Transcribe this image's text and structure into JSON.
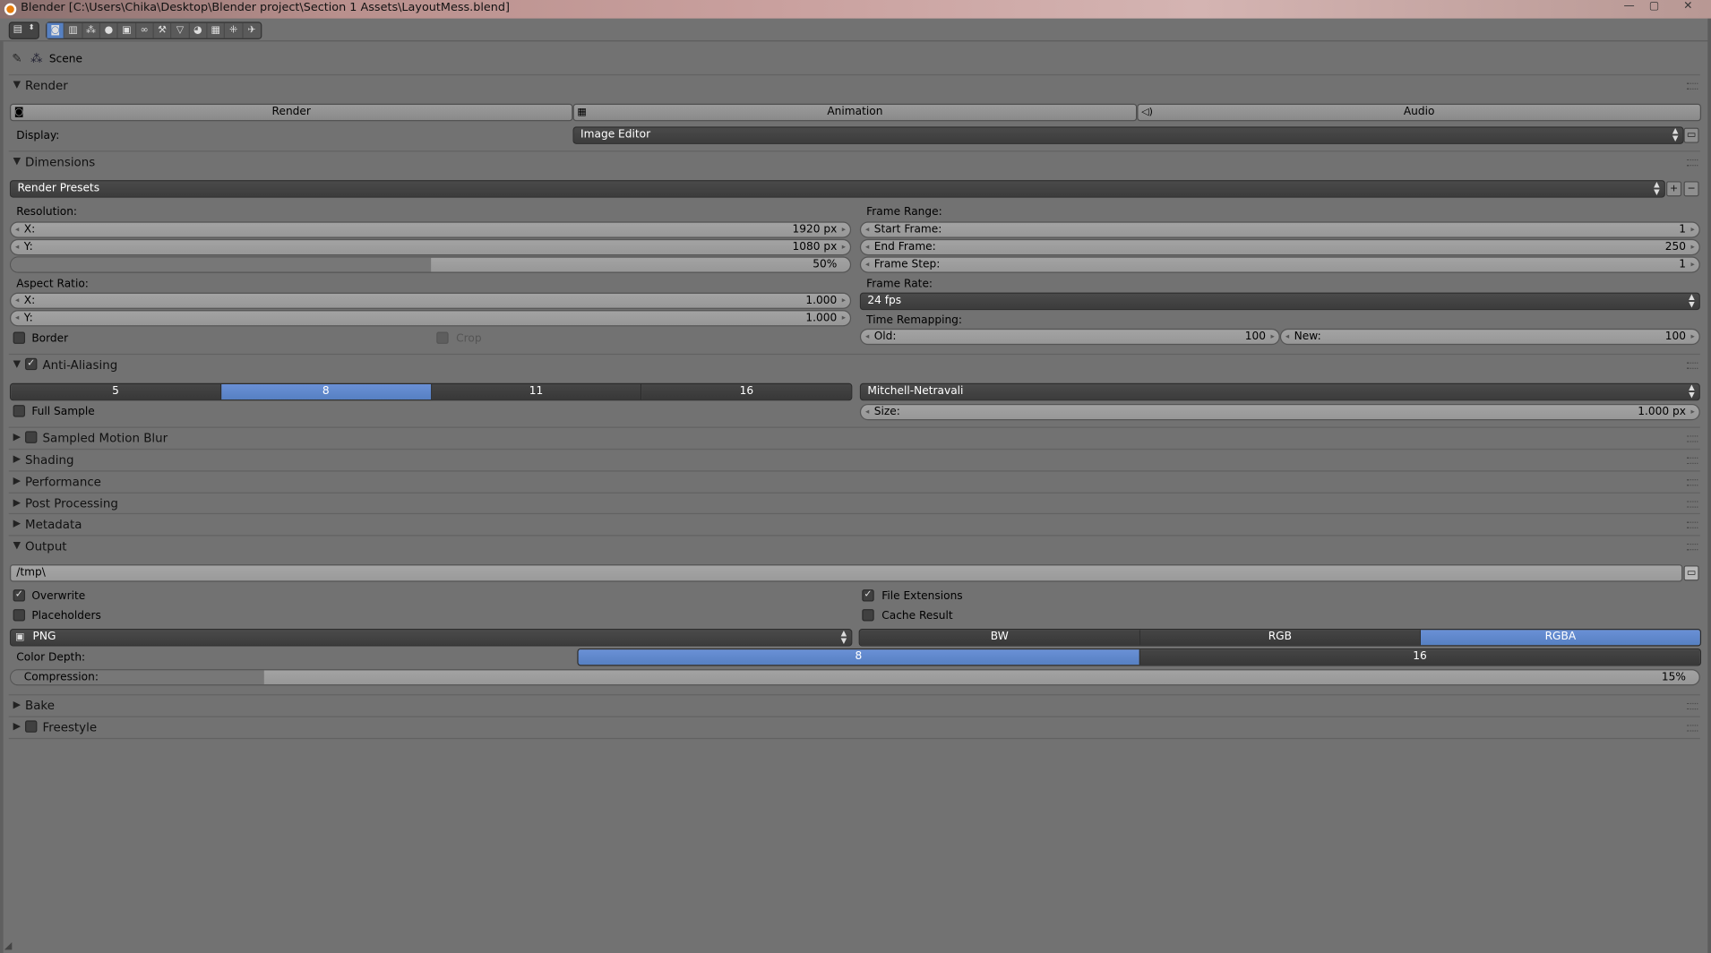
{
  "window": {
    "title": "Blender [C:\\Users\\Chika\\Desktop\\Blender project\\Section 1 Assets\\LayoutMess.blend]",
    "minimize": "—",
    "maximize": "▢",
    "close": "✕"
  },
  "context": {
    "label": "Scene"
  },
  "render": {
    "title": "Render",
    "buttons": [
      "Render",
      "Animation",
      "Audio"
    ],
    "display_label": "Display:",
    "display_value": "Image Editor"
  },
  "dimensions": {
    "title": "Dimensions",
    "presets": "Render Presets",
    "resolution_label": "Resolution:",
    "res_x_label": "X:",
    "res_x": "1920 px",
    "res_y_label": "Y:",
    "res_y": "1080 px",
    "res_pct": "50%",
    "res_pct_value": 0.5,
    "aspect_label": "Aspect Ratio:",
    "asp_x_label": "X:",
    "asp_x": "1.000",
    "asp_y_label": "Y:",
    "asp_y": "1.000",
    "border": "Border",
    "crop": "Crop",
    "frame_range_label": "Frame Range:",
    "start_label": "Start Frame:",
    "start": "1",
    "end_label": "End Frame:",
    "end": "250",
    "step_label": "Frame Step:",
    "step": "1",
    "frame_rate_label": "Frame Rate:",
    "frame_rate": "24 fps",
    "remap_label": "Time Remapping:",
    "old_label": "Old:",
    "old": "100",
    "new_label": "New:",
    "new": "100"
  },
  "antialiasing": {
    "title": "Anti-Aliasing",
    "enabled": true,
    "samples": [
      "5",
      "8",
      "11",
      "16"
    ],
    "selected": "8",
    "filter": "Mitchell-Netravali",
    "full_sample": "Full Sample",
    "size_label": "Size:",
    "size": "1.000 px"
  },
  "collapsed_panels": [
    {
      "title": "Sampled Motion Blur",
      "checkbox": true
    },
    {
      "title": "Shading",
      "checkbox": false
    },
    {
      "title": "Performance",
      "checkbox": false
    },
    {
      "title": "Post Processing",
      "checkbox": false
    },
    {
      "title": "Metadata",
      "checkbox": false
    }
  ],
  "output": {
    "title": "Output",
    "path": "/tmp\\",
    "overwrite": "Overwrite",
    "placeholders": "Placeholders",
    "file_extensions": "File Extensions",
    "cache_result": "Cache Result",
    "format": "PNG",
    "color_modes": [
      "BW",
      "RGB",
      "RGBA"
    ],
    "color_mode_selected": "RGBA",
    "color_depth_label": "Color Depth:",
    "depths": [
      "8",
      "16"
    ],
    "depth_selected": "8",
    "compression_label": "Compression:",
    "compression": "15%",
    "compression_value": 0.15
  },
  "bottom_panels": [
    {
      "title": "Bake",
      "checkbox": false
    },
    {
      "title": "Freestyle",
      "checkbox": true
    }
  ],
  "colors": {
    "accent": "#5680c2",
    "panel_bg": "#727272",
    "dark_widget": "#3c3c3c"
  }
}
